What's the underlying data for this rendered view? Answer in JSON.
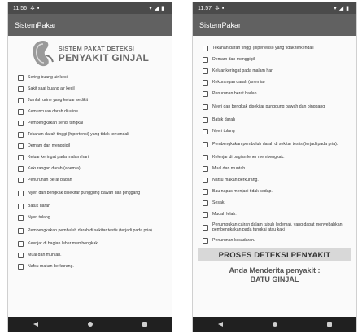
{
  "phone_left": {
    "status": {
      "time": "11:56"
    },
    "appbar": {
      "title": "SistemPakar"
    },
    "logo": {
      "line1": "SISTEM PAKAT DETEKSI",
      "line2": "PENYAKIT GINJAL"
    },
    "symptoms": [
      "Sering buang air kecil",
      "Sakit saat buang air kecil",
      "Jumlah urine yang keluar sedikit",
      "Kemunculan darah di urine",
      "Pembengkakan sendi tungkai",
      "Tekanan darah tinggi (hipertensi) yang tidak terkendali",
      "Demam dan menggigil",
      "Keluar keringat pada malam hari",
      "Kekurangan darah (anemia)",
      "Penurunan berat badan",
      "Nyeri dan bengkak disekitar punggung bawah dan pinggang",
      "Batuk darah",
      "Nyeri tulang",
      "Pembengkakan pembuluh darah di sekitar testis (terjadi pada pria).",
      "Keenjar di bagian leher membengkak.",
      "Mual dan muntah.",
      "Nafsu makan berkurang."
    ]
  },
  "phone_right": {
    "status": {
      "time": "11:57"
    },
    "appbar": {
      "title": "SistemPakar"
    },
    "symptoms": [
      "Tekanan darah tinggi (hipertensi) yang tidak terkendali",
      "Demam dan menggigil",
      "Keluar keringat pada malam hari",
      "Kekurangan darah (anemia)",
      "Penurunan berat badan",
      "Nyeri dan bengkak disekitar punggung bawah dan pinggang",
      "Batuk darah",
      "Nyeri tulang",
      "Pembengkakan pembuluh darah di sekitar testis (terjadi pada pria).",
      "Kelenjar di bagian leher membengkak.",
      "Mual dan muntah.",
      "Nafsu makan berkurang.",
      "Bau napas menjadi tidak sedap.",
      "Sesak.",
      "Mudah lelah.",
      "Penumpukan cairan dalam tubuh (edema), yang dapat menyebabkan pembengkakan pada tungkai atau kaki",
      "Penurunan kesadaran."
    ],
    "button_label": "PROSES DETEKSI PENYAKIT",
    "result_line1": "Anda Menderita penyakit :",
    "result_line2": "BATU GINJAL"
  },
  "icons": {
    "status_settings": "gear-icon",
    "status_sd": "sd-card-icon",
    "status_wifi": "wifi-icon",
    "status_signal": "signal-icon",
    "status_battery": "battery-icon",
    "nav_back": "back-icon",
    "nav_home": "home-icon",
    "nav_recent": "recent-apps-icon",
    "logo": "kidney-icon"
  }
}
